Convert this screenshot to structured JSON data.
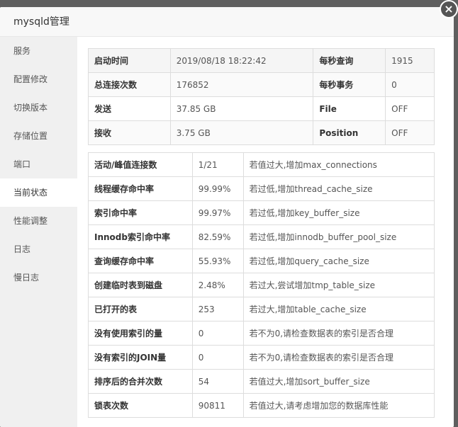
{
  "window": {
    "title": "mysqld管理",
    "close_symbol": "×"
  },
  "sidebar": {
    "items": [
      {
        "label": "服务"
      },
      {
        "label": "配置修改"
      },
      {
        "label": "切换版本"
      },
      {
        "label": "存储位置"
      },
      {
        "label": "端口"
      },
      {
        "label": "当前状态"
      },
      {
        "label": "性能调整"
      },
      {
        "label": "日志"
      },
      {
        "label": "慢日志"
      }
    ],
    "active": "当前状态"
  },
  "status_overview": [
    {
      "k1": "启动时间",
      "v1": "2019/08/18 18:22:42",
      "k2": "每秒查询",
      "v2": "1915"
    },
    {
      "k1": "总连接次数",
      "v1": "176852",
      "k2": "每秒事务",
      "v2": "0"
    },
    {
      "k1": "发送",
      "v1": "37.85 GB",
      "k2": "File",
      "v2": "OFF"
    },
    {
      "k1": "接收",
      "v1": "3.75 GB",
      "k2": "Position",
      "v2": "OFF"
    }
  ],
  "status_details": [
    {
      "name": "活动/峰值连接数",
      "value": "1/21",
      "advice": "若值过大,增加max_connections"
    },
    {
      "name": "线程缓存命中率",
      "value": "99.99%",
      "advice": "若过低,增加thread_cache_size"
    },
    {
      "name": "索引命中率",
      "value": "99.97%",
      "advice": "若过低,增加key_buffer_size"
    },
    {
      "name": "Innodb索引命中率",
      "value": "82.59%",
      "advice": "若过低,增加innodb_buffer_pool_size"
    },
    {
      "name": "查询缓存命中率",
      "value": "55.93%",
      "advice": "若过低,增加query_cache_size"
    },
    {
      "name": "创建临时表到磁盘",
      "value": "2.48%",
      "advice": "若过大,尝试增加tmp_table_size"
    },
    {
      "name": "已打开的表",
      "value": "253",
      "advice": "若过大,增加table_cache_size"
    },
    {
      "name": "没有使用索引的量",
      "value": "0",
      "advice": "若不为0,请检查数据表的索引是否合理"
    },
    {
      "name": "没有索引的JOIN量",
      "value": "0",
      "advice": "若不为0,请检查数据表的索引是否合理"
    },
    {
      "name": "排序后的合并次数",
      "value": "54",
      "advice": "若值过大,增加sort_buffer_size"
    },
    {
      "name": "锁表次数",
      "value": "90811",
      "advice": "若值过大,请考虑增加您的数据库性能"
    }
  ]
}
